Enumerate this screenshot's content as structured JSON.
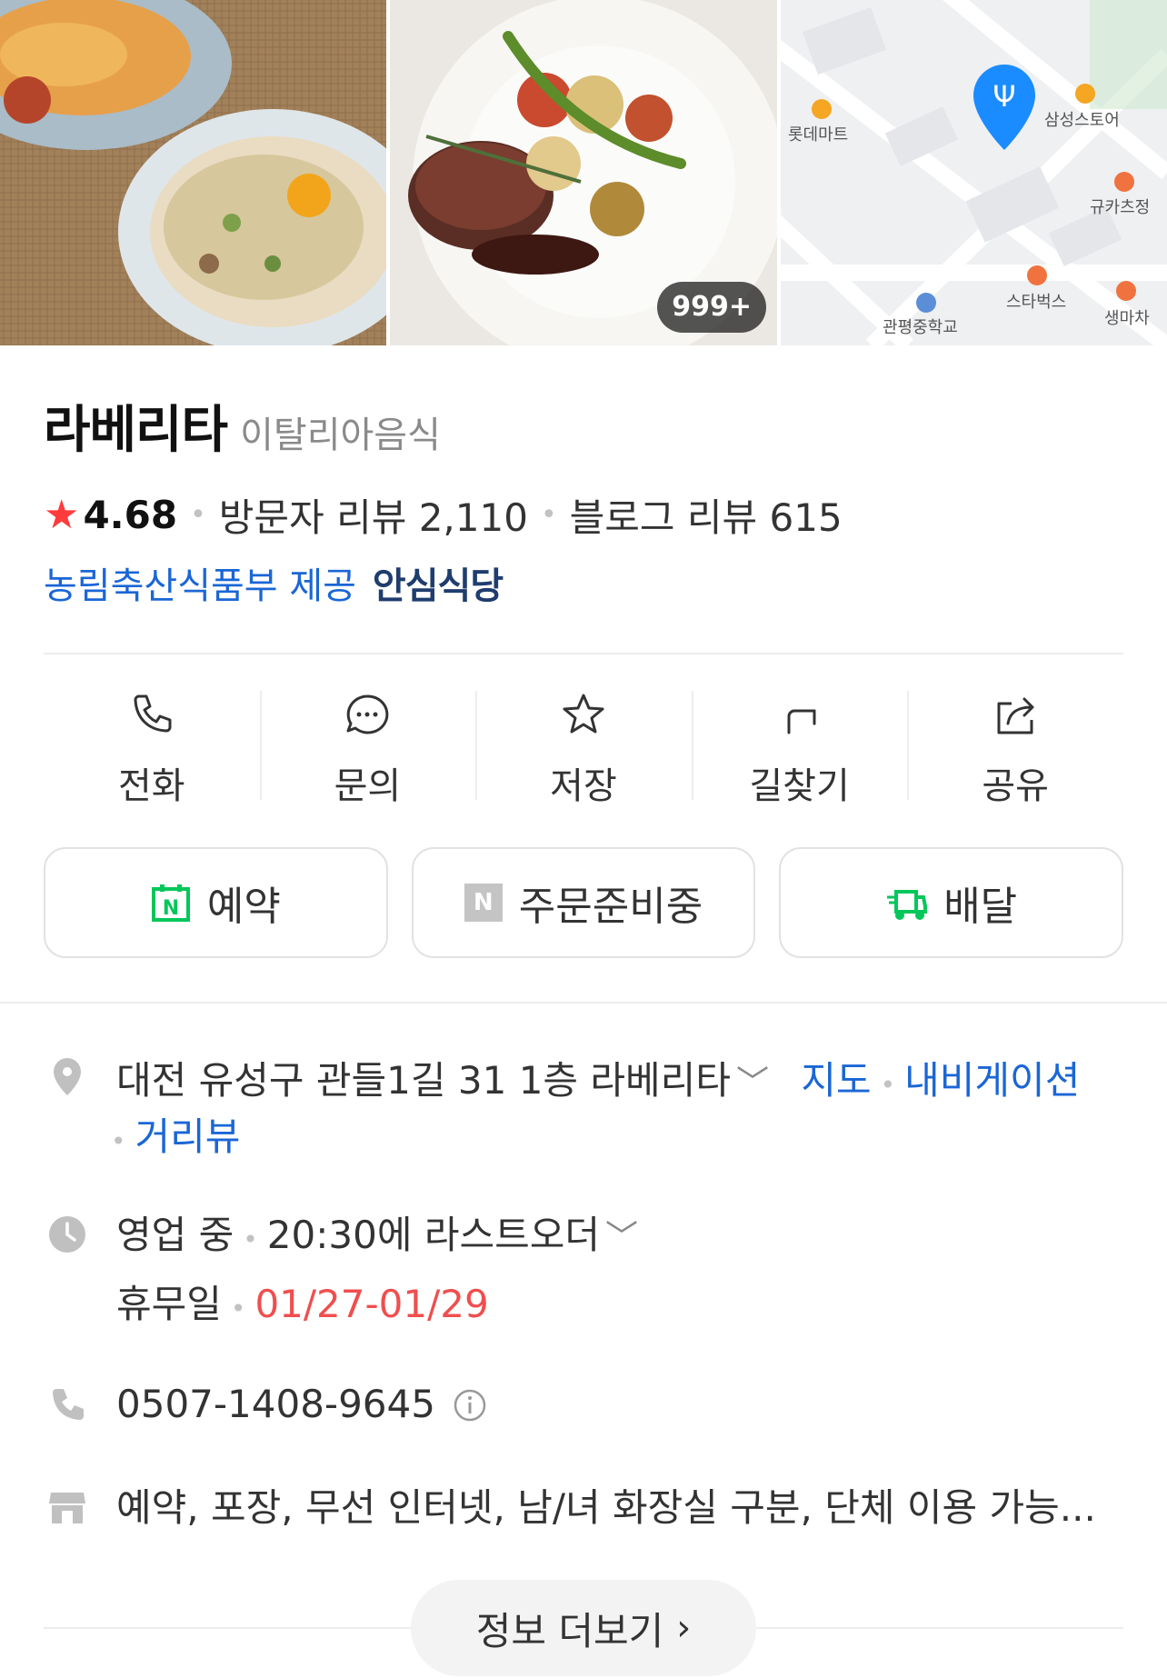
{
  "photos": {
    "count_badge": "999+",
    "map_labels": [
      "롯데마트",
      "삼성스토어",
      "규카츠정",
      "스타벅스",
      "관평중학교",
      "생마차"
    ]
  },
  "place": {
    "name": "라베리타",
    "category": "이탈리아음식",
    "rating": "4.68",
    "visitor_reviews": "방문자 리뷰 2,110",
    "blog_reviews": "블로그 리뷰 615",
    "provider": "농림축산식품부 제공",
    "safe_badge": "안심식당"
  },
  "actions": [
    {
      "label": "전화",
      "icon": "phone-icon"
    },
    {
      "label": "문의",
      "icon": "chat-icon"
    },
    {
      "label": "저장",
      "icon": "star-outline-icon"
    },
    {
      "label": "길찾기",
      "icon": "directions-icon"
    },
    {
      "label": "공유",
      "icon": "share-icon"
    }
  ],
  "buttons": {
    "reserve": "예약",
    "order": "주문준비중",
    "delivery": "배달"
  },
  "colors": {
    "naver_green": "#03c75a",
    "link_blue": "#1a66d6",
    "star_red": "#ff3b3b",
    "holiday_red": "#f04e4e",
    "map_pin": "#1a8cff"
  },
  "info": {
    "address": "대전 유성구 관들1길 31 1층 라베리타",
    "map_link": "지도",
    "navi_link": "내비게이션",
    "street_link": "거리뷰",
    "status": "영업 중",
    "last_order": "20:30에 라스트오더",
    "holiday_label": "휴무일",
    "holiday_dates": "01/27-01/29",
    "phone": "0507-1408-9645",
    "facilities": "예약, 포장, 무선 인터넷, 남/녀 화장실 구분, 단체 이용 가능..."
  },
  "more_info": "정보 더보기"
}
